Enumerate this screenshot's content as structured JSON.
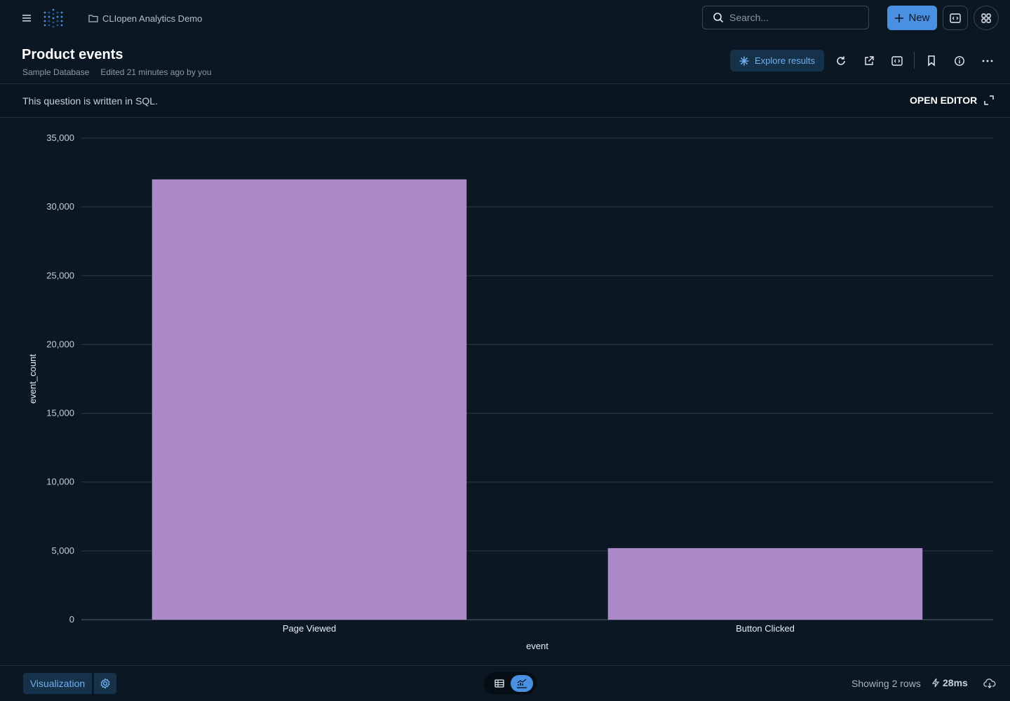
{
  "topbar": {
    "collection": "CLIopen Analytics Demo",
    "search_placeholder": "Search...",
    "new_label": "New"
  },
  "question": {
    "title": "Product events",
    "database": "Sample Database",
    "edited": "Edited 21 minutes ago by you",
    "explore_label": "Explore results"
  },
  "sql_bar": {
    "text": "This question is written in SQL.",
    "open_editor": "OPEN EDITOR"
  },
  "chart_data": {
    "type": "bar",
    "categories": [
      "Page Viewed",
      "Button Clicked"
    ],
    "values": [
      32000,
      5200
    ],
    "xlabel": "event",
    "ylabel": "event_count",
    "ylim": [
      0,
      35000
    ],
    "yticks": [
      "0",
      "5,000",
      "10,000",
      "15,000",
      "20,000",
      "25,000",
      "30,000",
      "35,000"
    ],
    "ytick_values": [
      0,
      5000,
      10000,
      15000,
      20000,
      25000,
      30000,
      35000
    ],
    "bar_color": "#ab8ac7",
    "grid": true
  },
  "footer": {
    "visualization_label": "Visualization",
    "row_count": "Showing 2 rows",
    "timing": "28ms"
  },
  "colors": {
    "background": "#0b1824",
    "accent": "#4a90e2"
  }
}
